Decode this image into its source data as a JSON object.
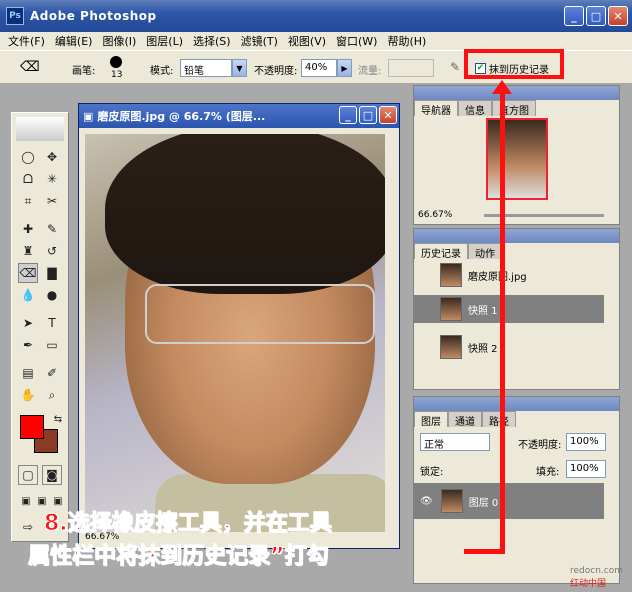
{
  "window": {
    "title": "Adobe Photoshop",
    "icon_text": "Ps"
  },
  "menu": [
    "文件(F)",
    "编辑(E)",
    "图像(I)",
    "图层(L)",
    "选择(S)",
    "滤镜(T)",
    "视图(V)",
    "窗口(W)",
    "帮助(H)"
  ],
  "options": {
    "brush_label": "画笔:",
    "brush_size": "13",
    "mode_label": "模式:",
    "mode_value": "铅笔",
    "opacity_label": "不透明度:",
    "opacity_value": "40%",
    "flow_label": "流量:",
    "erase_to_history_label": "抹到历史记录",
    "erase_to_history_checked": true
  },
  "document": {
    "title": "磨皮原图.jpg @ 66.7% (图层...",
    "zoom": "66.67%"
  },
  "navigator": {
    "tabs": [
      "导航器",
      "信息",
      "直方图"
    ],
    "zoom": "66.67%"
  },
  "history": {
    "tabs": [
      "历史记录",
      "动作"
    ],
    "items": [
      "磨皮原图.jpg",
      "快照 1",
      "快照 2"
    ]
  },
  "layers": {
    "tabs": [
      "图层",
      "通道",
      "路径"
    ],
    "blend_mode": "正常",
    "opacity_label": "不透明度:",
    "opacity_value": "100%",
    "lock_label": "锁定:",
    "fill_label": "填充:",
    "fill_value": "100%",
    "layer_name": "图层 0"
  },
  "annotation": {
    "line1": "8.选择橡皮擦工具，并在工具",
    "line2": "属性栏中将抹到历史记录”打勾",
    "color": "#ff1010"
  },
  "watermark": {
    "site": "redocn.com",
    "name": "红动中国"
  }
}
